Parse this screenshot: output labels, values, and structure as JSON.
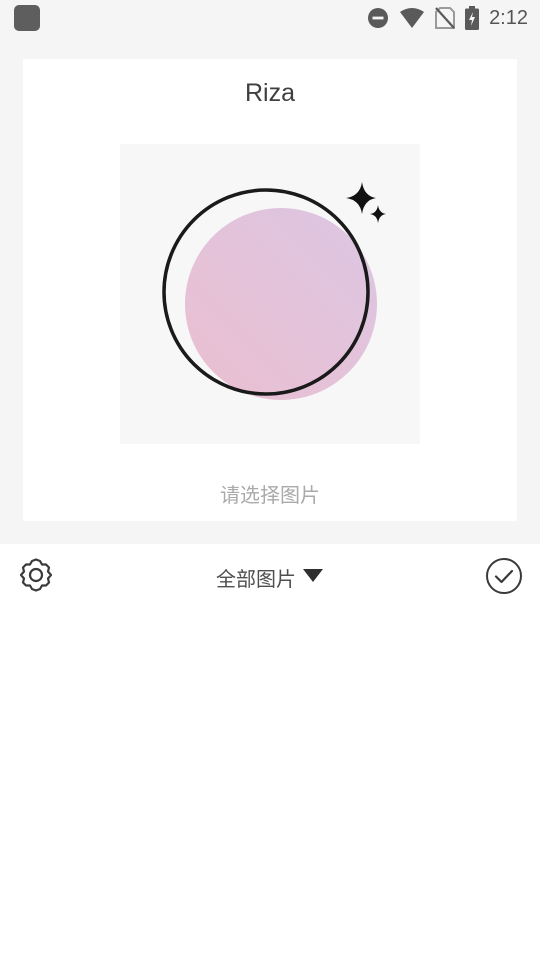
{
  "status_bar": {
    "time": "2:12",
    "icons": [
      "app-notification-icon",
      "do-not-disturb-icon",
      "wifi-icon",
      "no-sim-icon",
      "battery-charging-icon"
    ]
  },
  "preview": {
    "title": "Riza",
    "hint": "请选择图片",
    "image_icons": [
      "ring-icon",
      "sparkle-icon"
    ],
    "gradient_colors": [
      "#e8bfd2",
      "#dcc6e2"
    ]
  },
  "toolbar": {
    "album_label": "全部图片",
    "icons": [
      "gear-icon",
      "dropdown-triangle-icon",
      "check-circle-icon"
    ]
  },
  "colors": {
    "background": "#f5f5f5",
    "text": "#3f3f3f",
    "hint": "#aaaaaa"
  }
}
